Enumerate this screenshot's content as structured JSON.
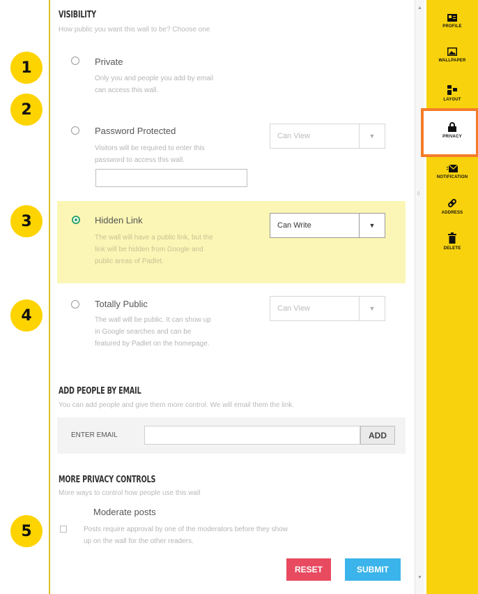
{
  "steps": [
    "1",
    "2",
    "3",
    "4",
    "5"
  ],
  "visibility": {
    "title": "VISIBILITY",
    "subtitle": "How public you want this wall to be? Choose one",
    "options": [
      {
        "label": "Private",
        "desc_lines": [
          "Only you and people you add by email",
          "can access this wall."
        ],
        "selected": false
      },
      {
        "label": "Password Protected",
        "desc_lines": [
          "Visitors will be required to enter this",
          "password to access this wall."
        ],
        "permission": "Can View",
        "password_value": "",
        "selected": false
      },
      {
        "label": "Hidden Link",
        "desc_lines": [
          "The wall will have a public link, but the",
          "link will be hidden from Google and",
          "public areas of Padlet."
        ],
        "permission": "Can Write",
        "selected": true
      },
      {
        "label": "Totally Public",
        "desc_lines": [
          "The wall will be public. It can show up",
          "in Google searches and can be",
          "featured by Padlet on the homepage."
        ],
        "permission": "Can View",
        "selected": false
      }
    ]
  },
  "add_people": {
    "title": "ADD PEOPLE BY EMAIL",
    "subtitle": "You can add people and give them more control. We will email them the link.",
    "email_label": "ENTER EMAIL",
    "email_value": "",
    "add_label": "ADD"
  },
  "more_controls": {
    "title": "MORE PRIVACY CONTROLS",
    "subtitle": "More ways to control how people use this wall",
    "moderate_label": "Moderate posts",
    "moderate_desc_lines": [
      "Posts require approval by one of the moderators before they show",
      "up on the wall for the other readers."
    ],
    "moderate_checked": false
  },
  "buttons": {
    "reset": "RESET",
    "submit": "SUBMIT"
  },
  "sidebar": {
    "items": [
      {
        "label": "PROFILE",
        "icon": "profile-icon"
      },
      {
        "label": "WALLPAPER",
        "icon": "wallpaper-icon"
      },
      {
        "label": "LAYOUT",
        "icon": "layout-icon"
      },
      {
        "label": "PRIVACY",
        "icon": "lock-icon",
        "active": true
      },
      {
        "label": "NOTIFICATION",
        "icon": "notification-icon"
      },
      {
        "label": "ADDRESS",
        "icon": "link-icon"
      },
      {
        "label": "DELETE",
        "icon": "trash-icon"
      }
    ]
  },
  "colors": {
    "sidebar_bg": "#f8d20c",
    "badge_bg": "#fdd300",
    "highlight_bg": "#fbf6b5",
    "active_border": "#f47c2a",
    "reset_bg": "#e84a5f",
    "submit_bg": "#3ab4ea",
    "radio_selected": "#2ea36a"
  }
}
